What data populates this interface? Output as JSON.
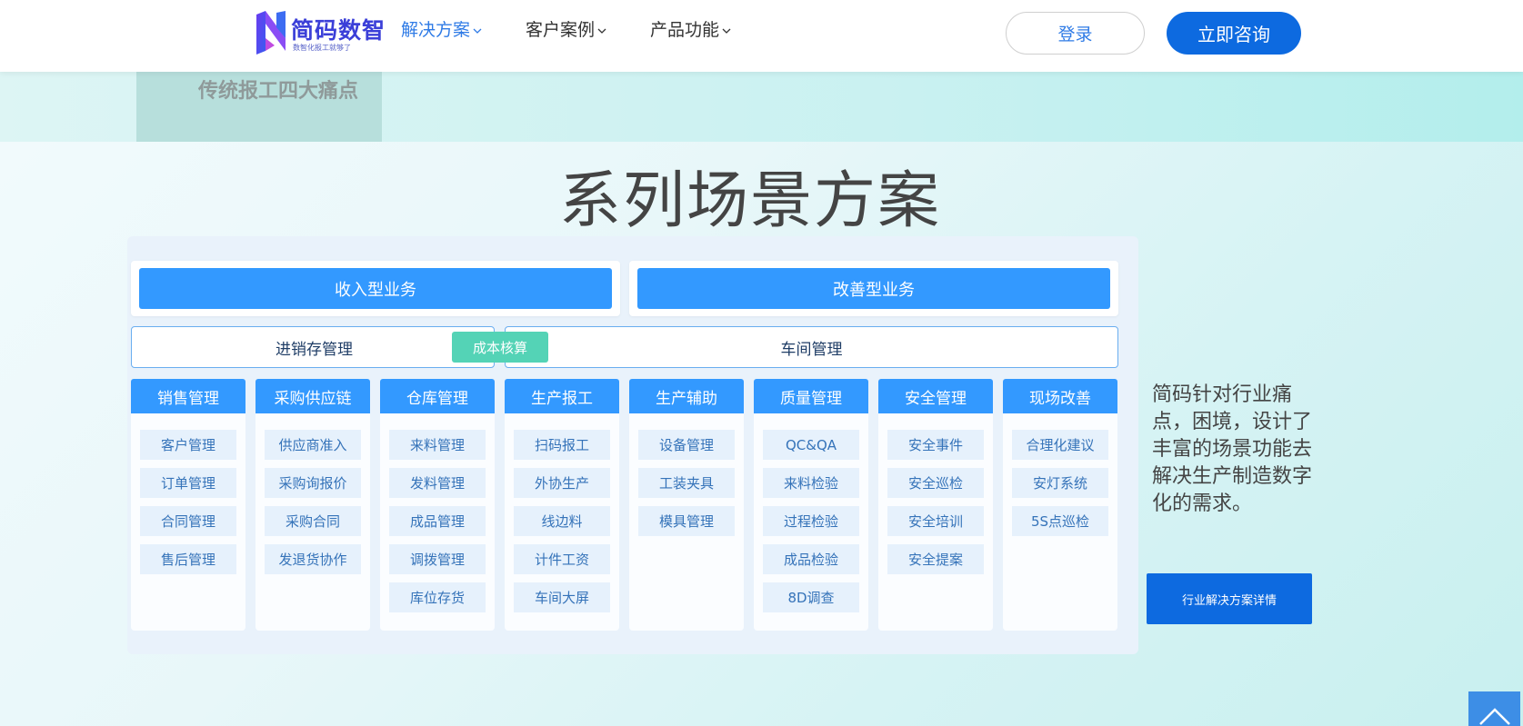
{
  "header": {
    "brand_name": "简码数智",
    "brand_slogan": "数智化报工就够了",
    "nav": [
      {
        "label": "解决方案",
        "active": true
      },
      {
        "label": "客户案例",
        "active": false
      },
      {
        "label": "产品功能",
        "active": false
      }
    ],
    "login_label": "登录",
    "consult_label": "立即咨询"
  },
  "banner": {
    "pain_points_label": "传统报工四大痛点"
  },
  "section": {
    "title": "系列场景方案"
  },
  "diagram": {
    "business_types": [
      "收入型业务",
      "改善型业务"
    ],
    "management_groups": [
      "进销存管理",
      "车间管理"
    ],
    "cost_tag": "成本核算",
    "columns": [
      {
        "title": "销售管理",
        "items": [
          "客户管理",
          "订单管理",
          "合同管理",
          "售后管理"
        ]
      },
      {
        "title": "采购供应链",
        "items": [
          "供应商准入",
          "采购询报价",
          "采购合同",
          "发退货协作"
        ]
      },
      {
        "title": "仓库管理",
        "items": [
          "来料管理",
          "发料管理",
          "成品管理",
          "调拨管理",
          "库位存货"
        ]
      },
      {
        "title": "生产报工",
        "items": [
          "扫码报工",
          "外协生产",
          "线边料",
          "计件工资",
          "车间大屏"
        ]
      },
      {
        "title": "生产辅助",
        "items": [
          "设备管理",
          "工装夹具",
          "模具管理"
        ]
      },
      {
        "title": "质量管理",
        "items": [
          "QC&QA",
          "来料检验",
          "过程检验",
          "成品检验",
          "8D调查"
        ]
      },
      {
        "title": "安全管理",
        "items": [
          "安全事件",
          "安全巡检",
          "安全培训",
          "安全提案"
        ]
      },
      {
        "title": "现场改善",
        "items": [
          "合理化建议",
          "安灯系统",
          "5S点巡检"
        ]
      }
    ]
  },
  "side": {
    "description": "简码针对行业痛点，困境，设计了丰富的场景功能去解决生产制造数字化的需求。",
    "detail_button": "行业解决方案详情"
  },
  "colors": {
    "primary": "#0d6ae0",
    "diagram_blue": "#3399ff",
    "cost_tag": "#54d3b6",
    "item_bg": "#e6f1fc"
  }
}
